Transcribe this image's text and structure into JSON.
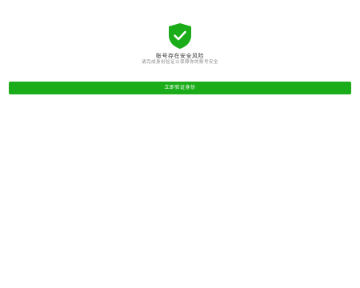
{
  "colors": {
    "accent": "#1aad19",
    "background": "#ffffff",
    "title_text": "#333333",
    "desc_text": "#888888",
    "button_text": "#ffffff"
  },
  "status": {
    "icon": "shield-check-icon",
    "title": "账号存在安全风险",
    "description": "请完成身份验证以保障你的账号安全"
  },
  "actions": {
    "primary_label": "立即验证身份"
  }
}
